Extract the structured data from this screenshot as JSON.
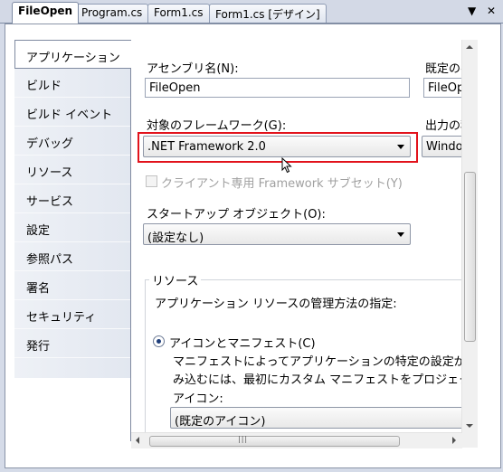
{
  "tabs": [
    {
      "label": "FileOpen",
      "active": true
    },
    {
      "label": "Program.cs",
      "active": false
    },
    {
      "label": "Form1.cs",
      "active": false
    },
    {
      "label": "Form1.cs [デザイン]",
      "active": false
    }
  ],
  "tab_controls": {
    "dropdown": "▼",
    "close": "✕"
  },
  "nav": {
    "items": [
      {
        "label": "アプリケーション",
        "active": true
      },
      {
        "label": "ビルド"
      },
      {
        "label": "ビルド イベント"
      },
      {
        "label": "デバッグ"
      },
      {
        "label": "リソース"
      },
      {
        "label": "サービス"
      },
      {
        "label": "設定"
      },
      {
        "label": "参照パス"
      },
      {
        "label": "署名"
      },
      {
        "label": "セキュリティ"
      },
      {
        "label": "発行"
      }
    ]
  },
  "form": {
    "assembly_name_label": "アセンブリ名(N):",
    "assembly_name_value": "FileOpen",
    "default_namespace_label": "既定の名",
    "default_namespace_value": "FileOpe",
    "target_framework_label": "対象のフレームワーク(G):",
    "target_framework_value": ".NET Framework 2.0",
    "output_type_label": "出力の種",
    "output_type_value": "Window",
    "client_profile_label": "クライアント専用 Framework サブセット(Y)",
    "startup_object_label": "スタートアップ オブジェクト(O):",
    "startup_object_value": "(設定なし)",
    "resources": {
      "group_title": "リソース",
      "description": "アプリケーション リソースの管理方法の指定:",
      "radio_label": "アイコンとマニフェスト(C)",
      "radio_desc_line1": "マニフェストによってアプリケーションの特定の設定が決定",
      "radio_desc_line2": "み込むには、最初にカスタム マニフェストをプロジェクトに",
      "icon_label": "アイコン:",
      "icon_value": "(既定のアイコン)"
    }
  },
  "scrollbar_grip": "|||",
  "colors": {
    "highlight": "#e2131c",
    "tab_strip": "#d3d9e6",
    "nav_bg": "#e8ecf3",
    "radio_dot": "#1e3e7a"
  }
}
